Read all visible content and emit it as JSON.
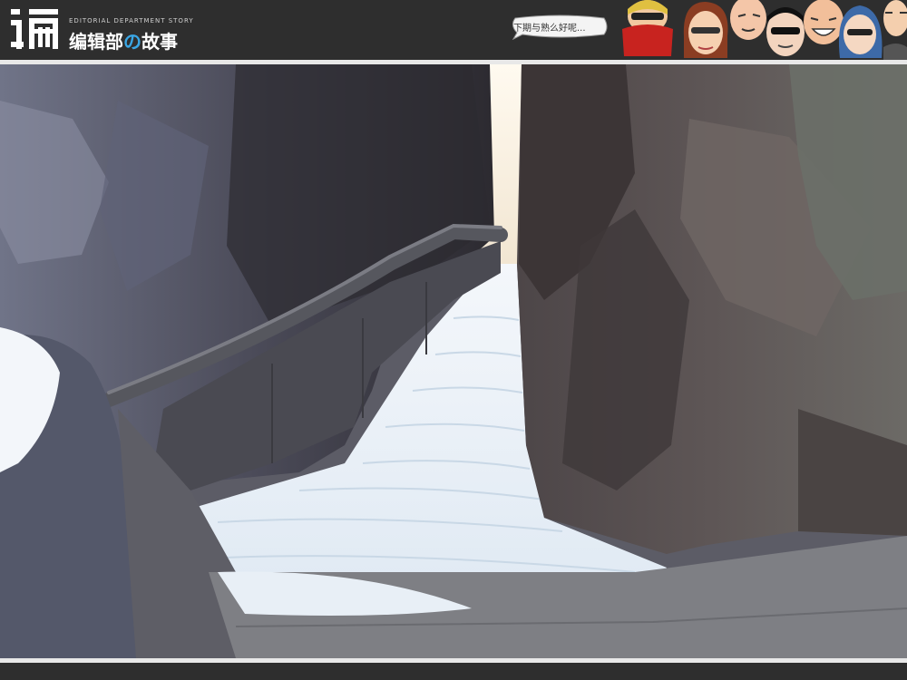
{
  "header": {
    "logo_glyph": "编",
    "subtitle": "EDITORIAL DEPARTMENT STORY",
    "title_part1": "编辑部",
    "title_no": "の",
    "title_part2": "故事",
    "bubble_text": "下期与熟么好呢..."
  },
  "colors": {
    "header_bg": "#2e2e2e",
    "accent_blue": "#3aa7e6",
    "snow": "#eef3f8",
    "rock_dark": "#3d3d48"
  },
  "icons": {
    "characters": [
      "scarf-face-icon",
      "girl-face-icon",
      "bald-face-icon",
      "glasses-face-icon",
      "laugh-face-icon",
      "blue-hair-face-icon",
      "man-face-icon"
    ]
  }
}
